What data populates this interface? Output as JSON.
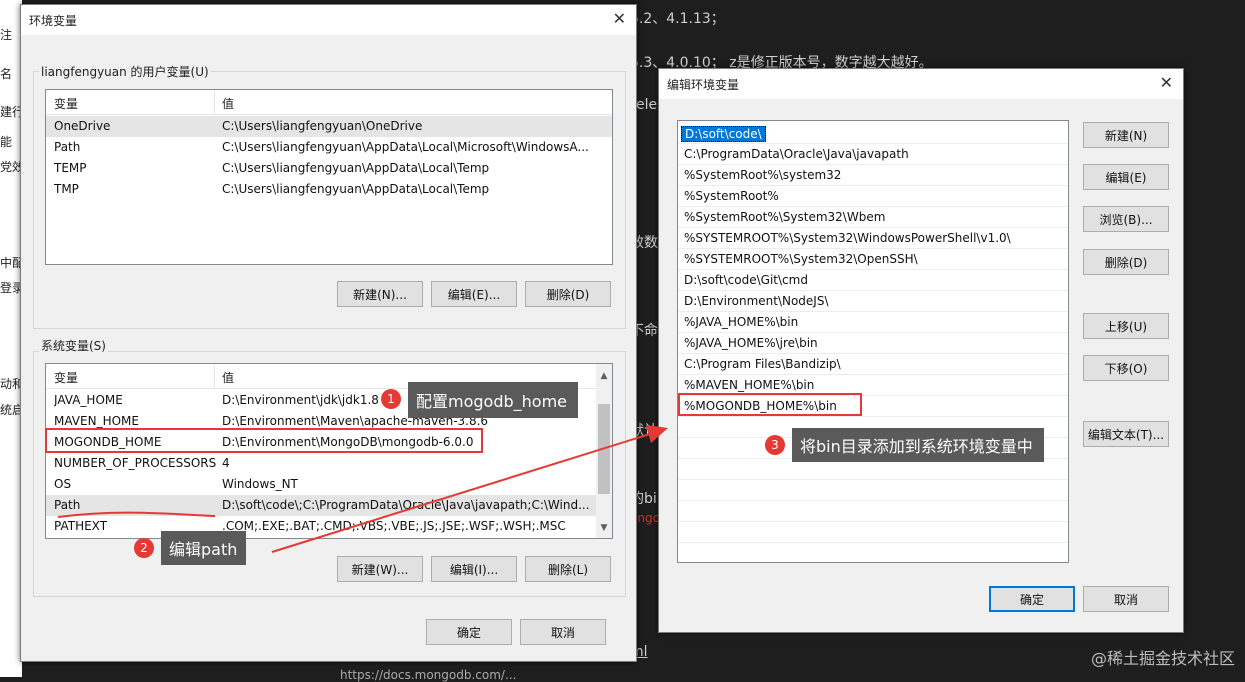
{
  "background": {
    "left_strip": [
      "注",
      "名",
      "建行才",
      "能",
      "党效",
      "中配",
      "登录",
      "动和",
      "统启"
    ],
    "right_text": [
      {
        "text": "5.2、4.1.13；"
      },
      {
        "text": "5.3、4.0.10； z是修正版本号，数字越大越好。"
      },
      {
        "text": "elea"
      },
      {
        "text": "效数"
      },
      {
        "text": "不命"
      },
      {
        "text": "默认"
      },
      {
        "text": "的bi"
      },
      {
        "text": "ongo",
        "red": true
      },
      {
        "text": "ml"
      },
      {
        "text": "https://docs.mongodb.com/..."
      }
    ]
  },
  "env_dialog": {
    "title": "环境变量",
    "close": "✕",
    "user_group_label": "liangfengyuan 的用户变量(U)",
    "col_var": "变量",
    "col_val": "值",
    "user_vars": [
      {
        "name": "OneDrive",
        "value": "C:\\Users\\liangfengyuan\\OneDrive"
      },
      {
        "name": "Path",
        "value": "C:\\Users\\liangfengyuan\\AppData\\Local\\Microsoft\\WindowsA..."
      },
      {
        "name": "TEMP",
        "value": "C:\\Users\\liangfengyuan\\AppData\\Local\\Temp"
      },
      {
        "name": "TMP",
        "value": "C:\\Users\\liangfengyuan\\AppData\\Local\\Temp"
      }
    ],
    "user_buttons": {
      "new": "新建(N)...",
      "edit": "编辑(E)...",
      "delete": "删除(D)"
    },
    "sys_group_label": "系统变量(S)",
    "sys_vars": [
      {
        "name": "JAVA_HOME",
        "value": "D:\\Environment\\jdk\\jdk1.8"
      },
      {
        "name": "MAVEN_HOME",
        "value": "D:\\Environment\\Maven\\apache-maven-3.8.6"
      },
      {
        "name": "MOGONDB_HOME",
        "value": "D:\\Environment\\MongoDB\\mongodb-6.0.0"
      },
      {
        "name": "NUMBER_OF_PROCESSORS",
        "value": "4"
      },
      {
        "name": "OS",
        "value": "Windows_NT"
      },
      {
        "name": "Path",
        "value": "D:\\soft\\code\\;C:\\ProgramData\\Oracle\\Java\\javapath;C:\\Wind..."
      },
      {
        "name": "PATHEXT",
        "value": ".COM;.EXE;.BAT;.CMD;.VBS;.VBE;.JS;.JSE;.WSF;.WSH;.MSC"
      }
    ],
    "sys_buttons": {
      "new": "新建(W)...",
      "edit": "编辑(I)...",
      "delete": "删除(L)"
    },
    "ok": "确定",
    "cancel": "取消"
  },
  "edit_dialog": {
    "title": "编辑环境变量",
    "close": "✕",
    "paths": [
      "D:\\soft\\code\\",
      "C:\\ProgramData\\Oracle\\Java\\javapath",
      "%SystemRoot%\\system32",
      "%SystemRoot%",
      "%SystemRoot%\\System32\\Wbem",
      "%SYSTEMROOT%\\System32\\WindowsPowerShell\\v1.0\\",
      "%SYSTEMROOT%\\System32\\OpenSSH\\",
      "D:\\soft\\code\\Git\\cmd",
      "D:\\Environment\\NodeJS\\",
      "%JAVA_HOME%\\bin",
      "%JAVA_HOME%\\jre\\bin",
      "C:\\Program Files\\Bandizip\\",
      "%MAVEN_HOME%\\bin",
      "%MOGONDB_HOME%\\bin"
    ],
    "buttons": {
      "new": "新建(N)",
      "edit": "编辑(E)",
      "browse": "浏览(B)...",
      "delete": "删除(D)",
      "up": "上移(U)",
      "down": "下移(O)",
      "edit_text": "编辑文本(T)..."
    },
    "ok": "确定",
    "cancel": "取消"
  },
  "annotations": {
    "step1": {
      "num": "1",
      "text": "配置mogodb_home"
    },
    "step2": {
      "num": "2",
      "text": "编辑path"
    },
    "step3": {
      "num": "3",
      "text": "将bin目录添加到系统环境变量中"
    },
    "accent": "#e53935"
  },
  "watermark": "@稀土掘金技术社区"
}
